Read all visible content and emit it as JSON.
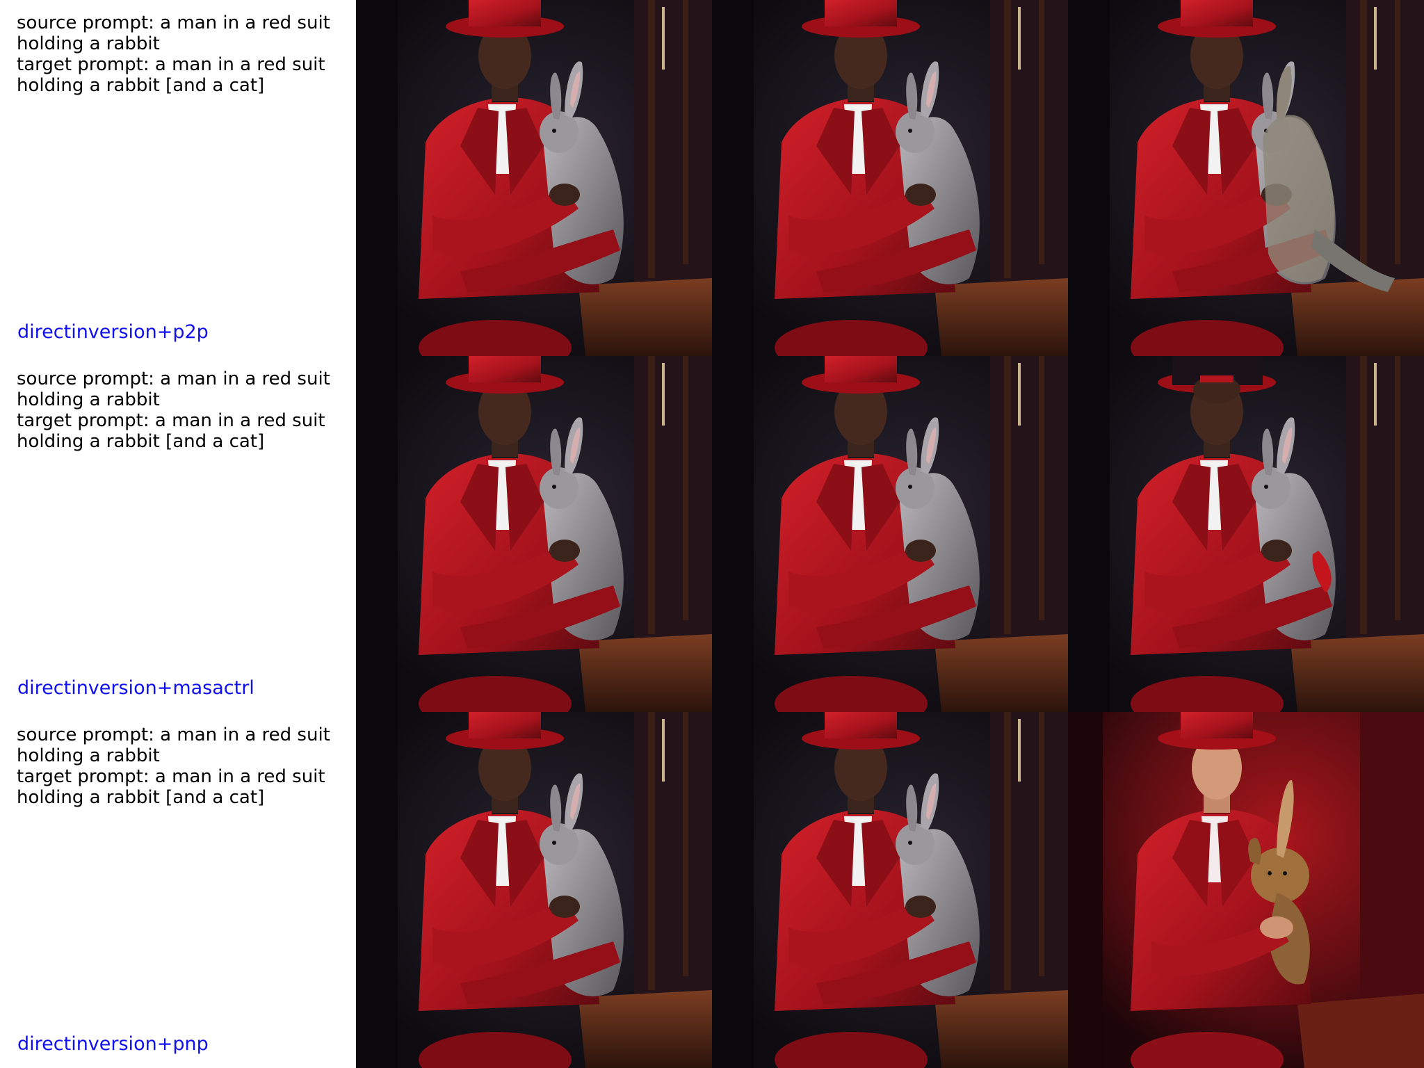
{
  "rows": [
    {
      "prompt": "source prompt: a man in a red suit\nholding a rabbit\ntarget prompt: a man in a red suit\nholding a rabbit [and a cat]",
      "method": "directinversion+p2p",
      "method_color": "#1010ee"
    },
    {
      "prompt": "source prompt: a man in a red suit\nholding a rabbit\ntarget prompt: a man in a red suit\nholding a rabbit [and a cat]",
      "method": "directinversion+masactrl",
      "method_color": "#1010ee"
    },
    {
      "prompt": "source prompt: a man in a red suit\nholding a rabbit\ntarget prompt: a man in a red suit\nholding a rabbit [and a cat]",
      "method": "directinversion+pnp",
      "method_color": "#1010ee"
    }
  ],
  "colors": {
    "suit_red": "#b3141d",
    "hat_red": "#c4141c",
    "background_dark": "#120f14",
    "rabbit_gray": "#8d8b8f",
    "wood": "#4a2416",
    "cat_tabby": "#a0703d",
    "pnp_red_background": "#6a0f12"
  }
}
